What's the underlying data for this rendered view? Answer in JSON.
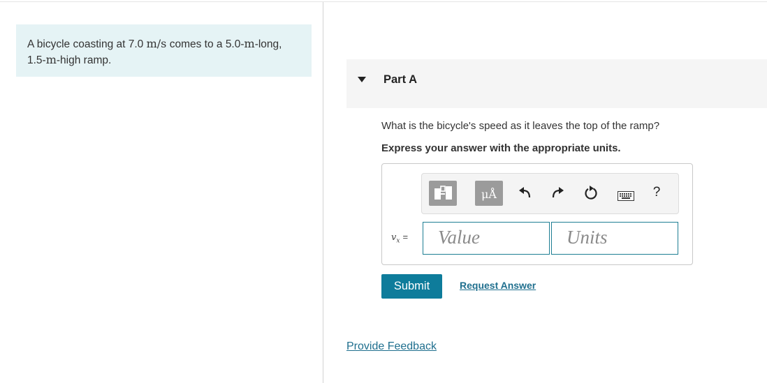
{
  "problem": {
    "text_pre": "A bicycle coasting at 7.0 ",
    "speed_unit": "m/s",
    "text_mid": " comes to a 5.0-",
    "unit_m1": "m",
    "text_mid2": "-long,",
    "text_line2_pre": "1.5-",
    "unit_m2": "m",
    "text_line2_post": "-high ramp."
  },
  "part": {
    "title": "Part A",
    "question": "What is the bicycle's speed as it leaves the top of the ramp?",
    "instruction": "Express your answer with the appropriate units."
  },
  "toolbar": {
    "units_label": "μÅ",
    "help_label": "?",
    "icons": [
      "templates-icon",
      "units-icon",
      "undo-icon",
      "redo-icon",
      "reset-icon",
      "keyboard-icon",
      "help-icon"
    ]
  },
  "answer": {
    "variable": "v",
    "subscript": "x",
    "equals": "=",
    "value_placeholder": "Value",
    "units_placeholder": "Units"
  },
  "actions": {
    "submit_label": "Submit",
    "request_answer_label": "Request Answer",
    "feedback_label": "Provide Feedback"
  },
  "colors": {
    "intro_background": "#e5f3f5",
    "accent": "#0e7c9b",
    "link": "#1f6f8e",
    "input_border": "#1d7e93"
  }
}
